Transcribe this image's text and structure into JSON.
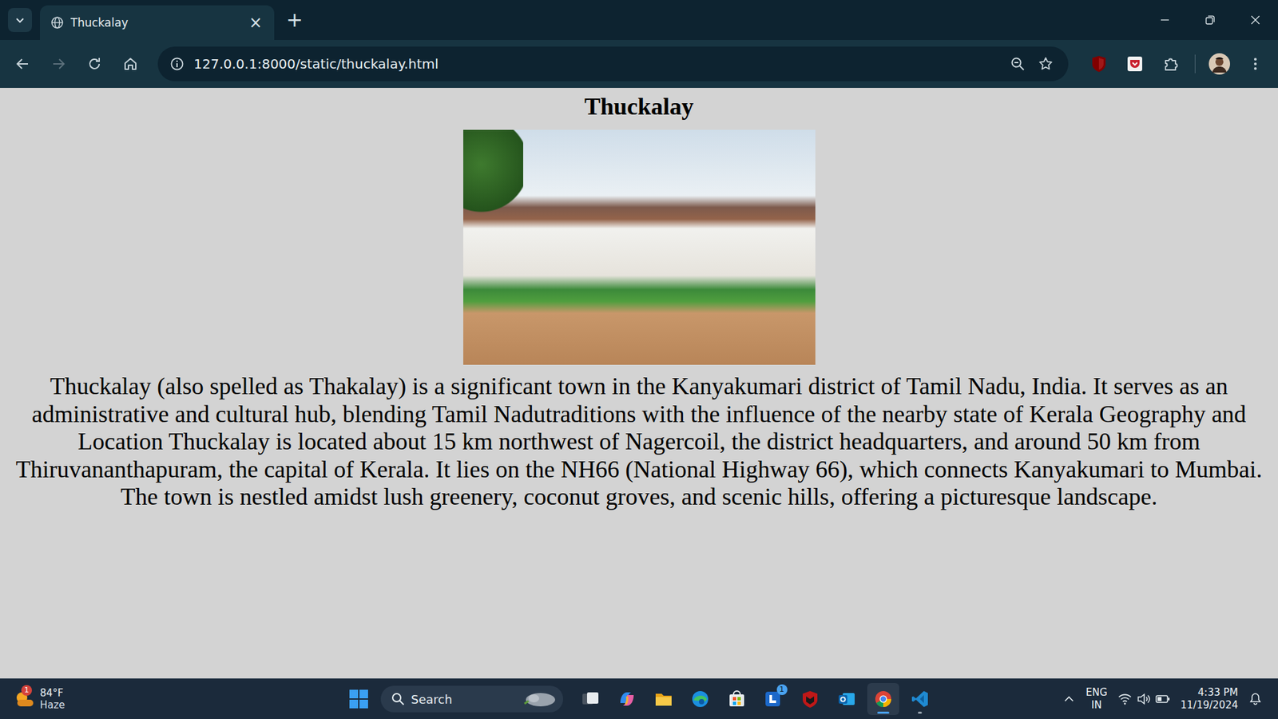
{
  "tabs": [
    {
      "label": "Thuckalay",
      "selected": true,
      "close": "×"
    }
  ],
  "new_tab": "+",
  "toolbar": {
    "back_enabled": true,
    "forward_enabled": false,
    "url": "127.0.0.1:8000/static/thuckalay.html",
    "zoomed": true,
    "bookmarked": false
  },
  "page": {
    "heading": "Thuckalay",
    "paragraph": "Thuckalay (also spelled as Thakalay) is a significant town in the Kanyakumari district of Tamil Nadu, India. It serves as an administrative and cultural hub, blending Tamil Nadutraditions with the influence of the nearby state of Kerala Geography and Location Thuckalay is located about 15 km northwest of Nagercoil, the district headquarters, and around 50 km from Thiruvananthapuram, the capital of Kerala. It lies on the NH66 (National Highway 66), which connects Kanyakumari to Mumbai. The town is nestled amidst lush greenery, coconut groves, and scenic hills, offering a picturesque landscape."
  },
  "taskbar": {
    "weather": {
      "temp": "84°F",
      "condition": "Haze",
      "badge": "1"
    },
    "search": {
      "placeholder": "Search"
    },
    "apps": [
      {
        "kind": "taskview",
        "running": false,
        "selected": false,
        "badge": ""
      },
      {
        "kind": "copilot",
        "running": false,
        "selected": false,
        "badge": ""
      },
      {
        "kind": "explorer",
        "running": false,
        "selected": false,
        "badge": ""
      },
      {
        "kind": "edge",
        "running": false,
        "selected": false,
        "badge": ""
      },
      {
        "kind": "store",
        "running": false,
        "selected": false,
        "badge": ""
      },
      {
        "kind": "lapp",
        "running": false,
        "selected": false,
        "badge": "1"
      },
      {
        "kind": "mcafee",
        "running": false,
        "selected": false,
        "badge": ""
      },
      {
        "kind": "outlook",
        "running": false,
        "selected": false,
        "badge": ""
      },
      {
        "kind": "chrome",
        "running": true,
        "selected": true,
        "badge": ""
      },
      {
        "kind": "vscode",
        "running": true,
        "selected": false,
        "badge": ""
      }
    ],
    "tray": {
      "language": "ENG",
      "region": "IN",
      "time": "4:33 PM",
      "date": "11/19/2024"
    }
  }
}
